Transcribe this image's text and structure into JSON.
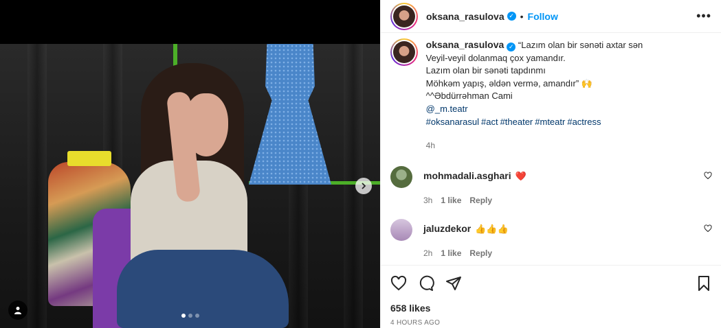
{
  "post": {
    "username": "oksana_rasulova",
    "follow_label": "Follow",
    "more_label": "•••",
    "caption_lines": [
      "“Lazım olan bir sənəti axtar sən",
      "Veyil-veyil dolanmaq çox yamandır.",
      "Lazım olan bir sənəti tapdınmı",
      "Möhkəm yapış, əldən vermə, amandır” 🙌",
      "^^Əbdürrəhman Cami"
    ],
    "mention": "@_m.teatr",
    "hashtags": [
      "#oksanarasul",
      "#act",
      "#theater",
      "#mteatr",
      "#actress"
    ],
    "caption_time": "4h",
    "likes": "658 likes",
    "posted_ago": "4 HOURS AGO"
  },
  "comments": [
    {
      "username": "mohmadali.asghari",
      "text": "❤️",
      "time": "3h",
      "likes": "1 like",
      "reply": "Reply"
    },
    {
      "username": "jaluzdekor",
      "text": "👍👍👍",
      "time": "2h",
      "likes": "1 like",
      "reply": "Reply"
    }
  ],
  "carousel": {
    "slides": 3,
    "current": 1
  },
  "colors": {
    "accent": "#0095f6",
    "link": "#00376b",
    "muted": "#737373"
  }
}
